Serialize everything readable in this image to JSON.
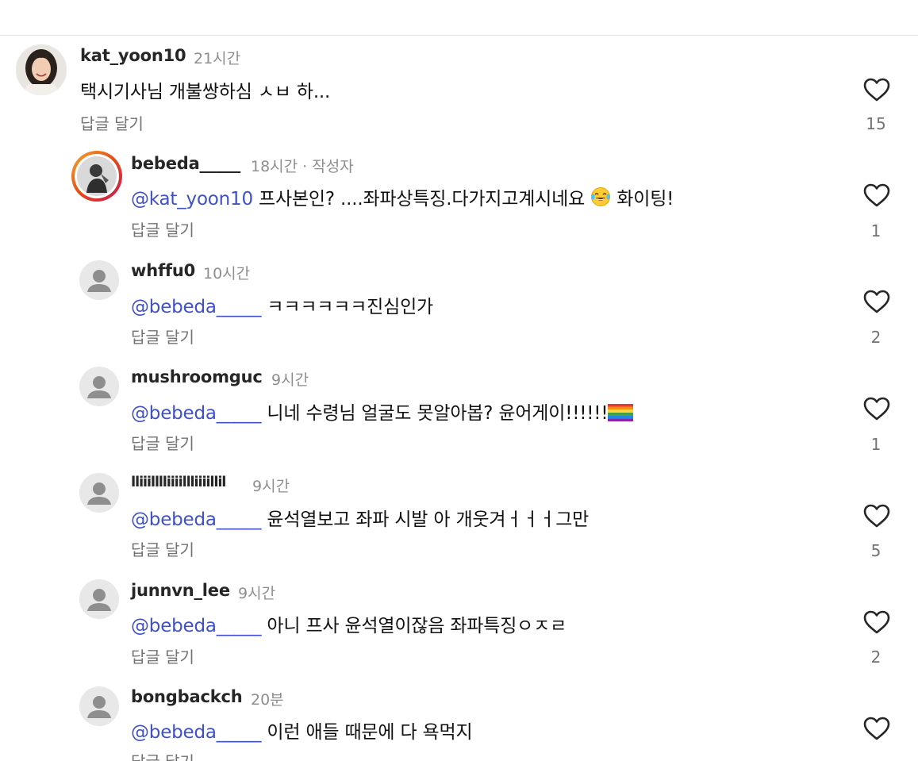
{
  "comments": [
    {
      "username": "kat_yoon10",
      "time": "21시간",
      "mention": "",
      "text": "택시기사님 개불쌍하심 ㅅㅂ 하...",
      "reply_label": "답글 달기",
      "likes": "15",
      "avatar": "profile-photo"
    },
    {
      "username": "bebeda_____",
      "time": "18시간",
      "author_tag": " · 작성자",
      "mention": "@kat_yoon10",
      "text": " 프사본인? ....좌파상특징.다가지고계시네요",
      "text_after_emoji": " 화이팅!",
      "emoji": "tears-of-joy-emoji",
      "reply_label": "답글 달기",
      "likes": "1",
      "avatar": "story-ring-photo"
    },
    {
      "username": "whffu0",
      "time": "10시간",
      "mention": "@bebeda_____",
      "text": " ㅋㅋㅋㅋㅋㅋ진심인가",
      "reply_label": "답글 달기",
      "likes": "2",
      "avatar": "default-avatar"
    },
    {
      "username": "mushroomguc",
      "time": "9시간",
      "mention": "@bebeda_____",
      "text": " 니네 수령님 얼굴도 못알아봅? 윤어게이!!!!!!",
      "emoji": "rainbow-flag-emoji",
      "reply_label": "답글 달기",
      "likes": "1",
      "avatar": "default-avatar"
    },
    {
      "username": "lliiilllliiiillliiiillil",
      "time": "9시간",
      "mention": "@bebeda_____",
      "text": " 윤석열보고 좌파 시발 아 개웃겨ㅓㅓㅓ그만",
      "reply_label": "답글 달기",
      "likes": "5",
      "avatar": "default-avatar"
    },
    {
      "username": "junnvn_lee",
      "time": "9시간",
      "mention": "@bebeda_____",
      "text": " 아니 프사 윤석열이잖음 좌파특징ㅇㅈㄹ",
      "reply_label": "답글 달기",
      "likes": "2",
      "avatar": "default-avatar"
    },
    {
      "username": "bongbackch",
      "time": "20분",
      "mention": "@bebeda_____",
      "text": " 이런 애들 때문에 다 욕먹지",
      "reply_label": "답글 달기",
      "likes": "",
      "avatar": "default-avatar"
    }
  ],
  "colors": {
    "mention": "#3f51c4",
    "meta": "#8e8e8e",
    "divider": "#e6e6e6",
    "story_ring_start": "#f9a825",
    "story_ring_end": "#c2185b"
  }
}
